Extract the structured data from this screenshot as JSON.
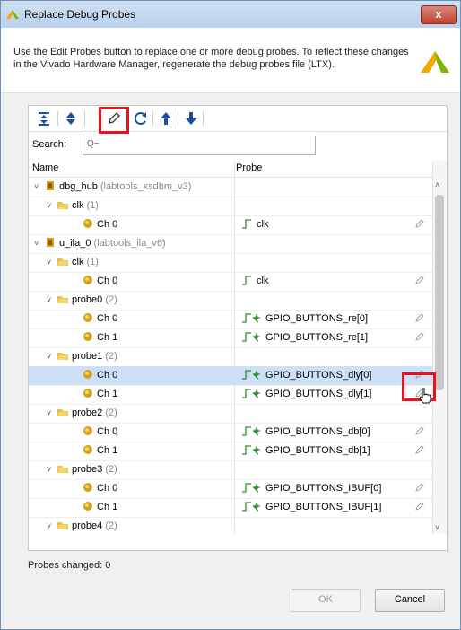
{
  "window": {
    "title": "Replace Debug Probes",
    "close_label": "x"
  },
  "header": {
    "description": "Use the Edit Probes button to replace one or more debug probes. To reflect these changes in the Vivado Hardware Manager, regenerate the debug probes file (LTX)."
  },
  "toolbar": {
    "buttons": [
      "collapse-all",
      "expand-all",
      "edit-probes",
      "refresh",
      "move-up",
      "move-down"
    ],
    "highlighted": "edit-probes"
  },
  "search": {
    "label": "Search:",
    "placeholder": "Q~",
    "value": ""
  },
  "tree": {
    "columns": [
      "Name",
      "Probe"
    ],
    "rows": [
      {
        "name": "dbg_hub",
        "detail": "(labtools_xsdbm_v3)",
        "probe": "",
        "chev": "˅"
      },
      {
        "name": "clk",
        "detail": "(1)",
        "probe": "",
        "chev": "˅"
      },
      {
        "name": "Ch 0",
        "detail": "",
        "probe": "clk",
        "chev": ""
      },
      {
        "name": "u_ila_0",
        "detail": "(labtools_ila_v6)",
        "probe": "",
        "chev": "˅"
      },
      {
        "name": "clk",
        "detail": "(1)",
        "probe": "",
        "chev": "˅"
      },
      {
        "name": "Ch 0",
        "detail": "",
        "probe": "clk",
        "chev": ""
      },
      {
        "name": "probe0",
        "detail": "(2)",
        "probe": "",
        "chev": "˅"
      },
      {
        "name": "Ch 0",
        "detail": "",
        "probe": "GPIO_BUTTONS_re[0]",
        "chev": ""
      },
      {
        "name": "Ch 1",
        "detail": "",
        "probe": "GPIO_BUTTONS_re[1]",
        "chev": ""
      },
      {
        "name": "probe1",
        "detail": "(2)",
        "probe": "",
        "chev": "˅"
      },
      {
        "name": "Ch 0",
        "detail": "",
        "probe": "GPIO_BUTTONS_dly[0]",
        "chev": ""
      },
      {
        "name": "Ch 1",
        "detail": "",
        "probe": "GPIO_BUTTONS_dly[1]",
        "chev": ""
      },
      {
        "name": "probe2",
        "detail": "(2)",
        "probe": "",
        "chev": "˅"
      },
      {
        "name": "Ch 0",
        "detail": "",
        "probe": "GPIO_BUTTONS_db[0]",
        "chev": ""
      },
      {
        "name": "Ch 1",
        "detail": "",
        "probe": "GPIO_BUTTONS_db[1]",
        "chev": ""
      },
      {
        "name": "probe3",
        "detail": "(2)",
        "probe": "",
        "chev": "˅"
      },
      {
        "name": "Ch 0",
        "detail": "",
        "probe": "GPIO_BUTTONS_IBUF[0]",
        "chev": ""
      },
      {
        "name": "Ch 1",
        "detail": "",
        "probe": "GPIO_BUTTONS_IBUF[1]",
        "chev": ""
      },
      {
        "name": "probe4",
        "detail": "(2)",
        "probe": "",
        "chev": "˅"
      }
    ],
    "selected_row": 10
  },
  "status": {
    "text": "Probes changed: 0"
  },
  "buttons": {
    "ok_label": "OK",
    "cancel_label": "Cancel"
  },
  "colors": {
    "accent": "#e8121e",
    "selection": "#cce0f8",
    "clock_wave": "#2d8f2d",
    "bus_icon": "#d4a017"
  }
}
